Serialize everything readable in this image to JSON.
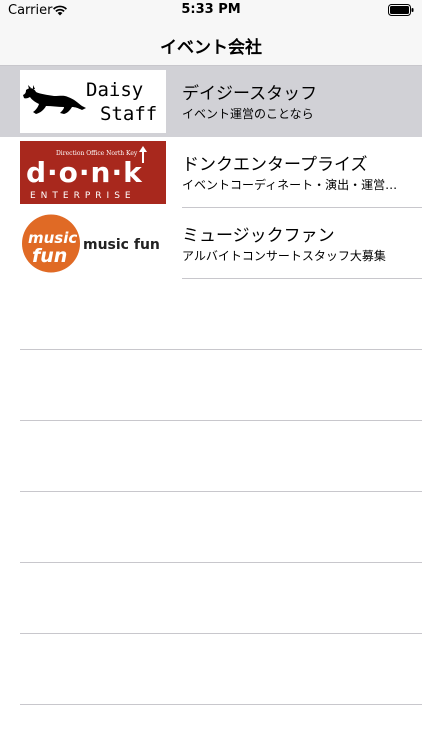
{
  "status_bar": {
    "carrier": "Carrier",
    "time": "5:33 PM"
  },
  "nav_bar": {
    "title": "イベント会社"
  },
  "companies": [
    {
      "name": "デイジースタッフ",
      "description": "イベント運営のことなら",
      "logo_text_line1": "Daisy",
      "logo_text_line2": "Staff",
      "selected": true
    },
    {
      "name": "ドンクエンタープライズ",
      "description": "イベントコーディネート・演出・運営・…",
      "logo_small_text": "Direction Office North Key",
      "logo_main_text": "d·o·n·k",
      "logo_sub_text": "ENTERPRISE",
      "selected": false
    },
    {
      "name": "ミュージックファン",
      "description": "アルバイトコンサートスタッフ大募集",
      "logo_badge_line1": "music",
      "logo_badge_line2": "fun",
      "logo_text": "music fun",
      "selected": false
    }
  ],
  "colors": {
    "bar_background": "#f7f7f7",
    "selected_row": "#d1d1d6",
    "separator": "#c8c7cc",
    "donk_red": "#a8281d",
    "musicfun_orange": "#e06a25"
  }
}
